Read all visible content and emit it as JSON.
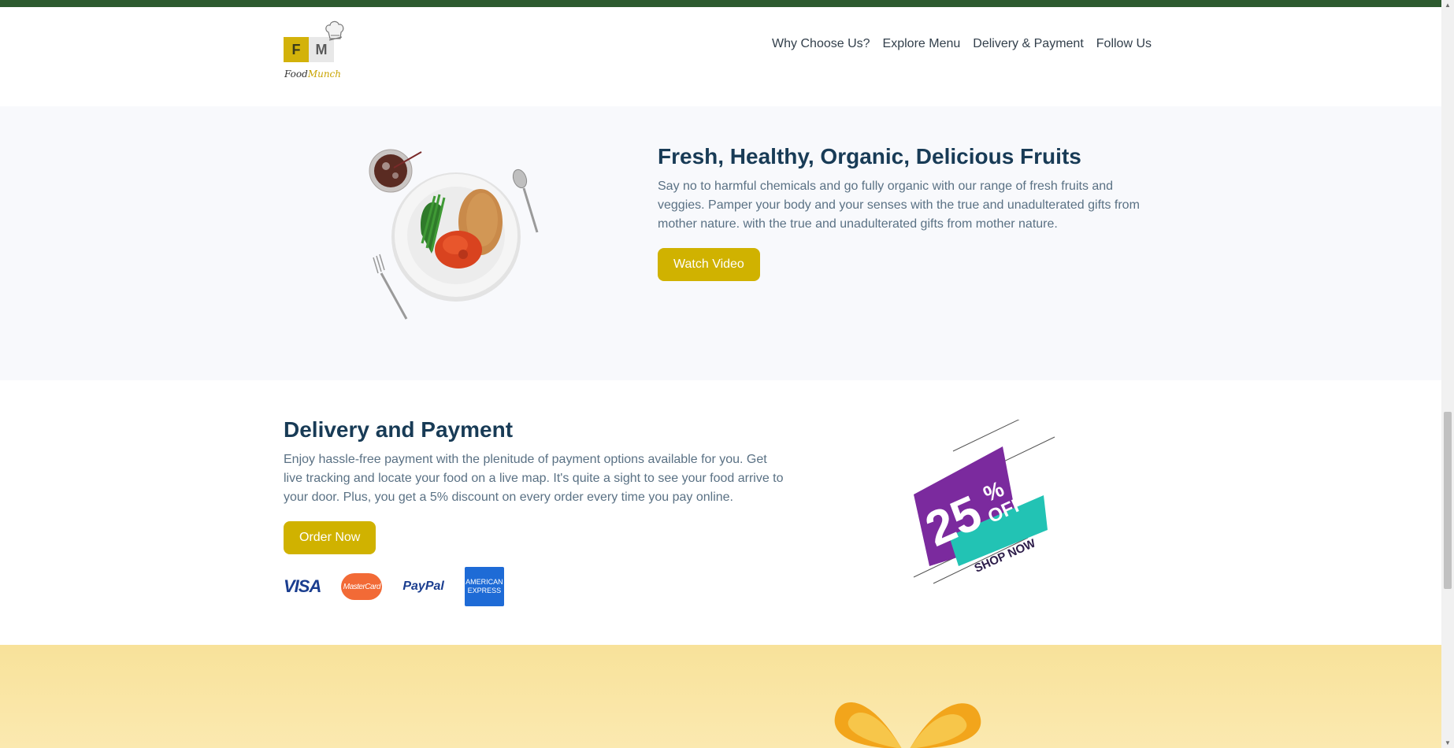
{
  "colors": {
    "topbar": "#2d5a2f",
    "heading": "#183b56",
    "text": "#5a7184",
    "button": "#d0b200",
    "section_bg": "#f8f9fc",
    "discount_purple": "#7b2a9e",
    "discount_teal": "#22c3b4"
  },
  "header": {
    "logo": {
      "letter_f": "F",
      "letter_m": "M",
      "brand_food": "Food",
      "brand_munch": "Munch"
    },
    "nav": [
      {
        "label": "Why Choose Us?"
      },
      {
        "label": "Explore Menu"
      },
      {
        "label": "Delivery & Payment"
      },
      {
        "label": "Follow Us"
      }
    ]
  },
  "fruits": {
    "title": "Fresh, Healthy, Organic, Delicious Fruits",
    "description": "Say no to harmful chemicals and go fully organic with our range of fresh fruits and veggies. Pamper your body and your senses with the true and unadulterated gifts from mother nature. with the true and unadulterated gifts from mother nature.",
    "button": "Watch Video"
  },
  "delivery": {
    "title": "Delivery and Payment",
    "description": "Enjoy hassle-free payment with the plenitude of payment options available for you. Get live tracking and locate your food on a live map. It's quite a sight to see your food arrive to your door. Plus, you get a 5% discount on every order every time you pay online.",
    "button": "Order Now",
    "payments": {
      "visa": "VISA",
      "mastercard": "MasterCard",
      "paypal": "PayPal",
      "amex_line1": "AMERICAN",
      "amex_line2": "EXPRESS"
    },
    "discount": {
      "value": "25",
      "percent": "%",
      "off": "OFF",
      "cta": "SHOP NOW"
    }
  },
  "icons": [
    "chef-hat-icon",
    "plate-icon",
    "drink-icon",
    "fork-icon",
    "spoon-icon",
    "gift-bow-icon"
  ]
}
